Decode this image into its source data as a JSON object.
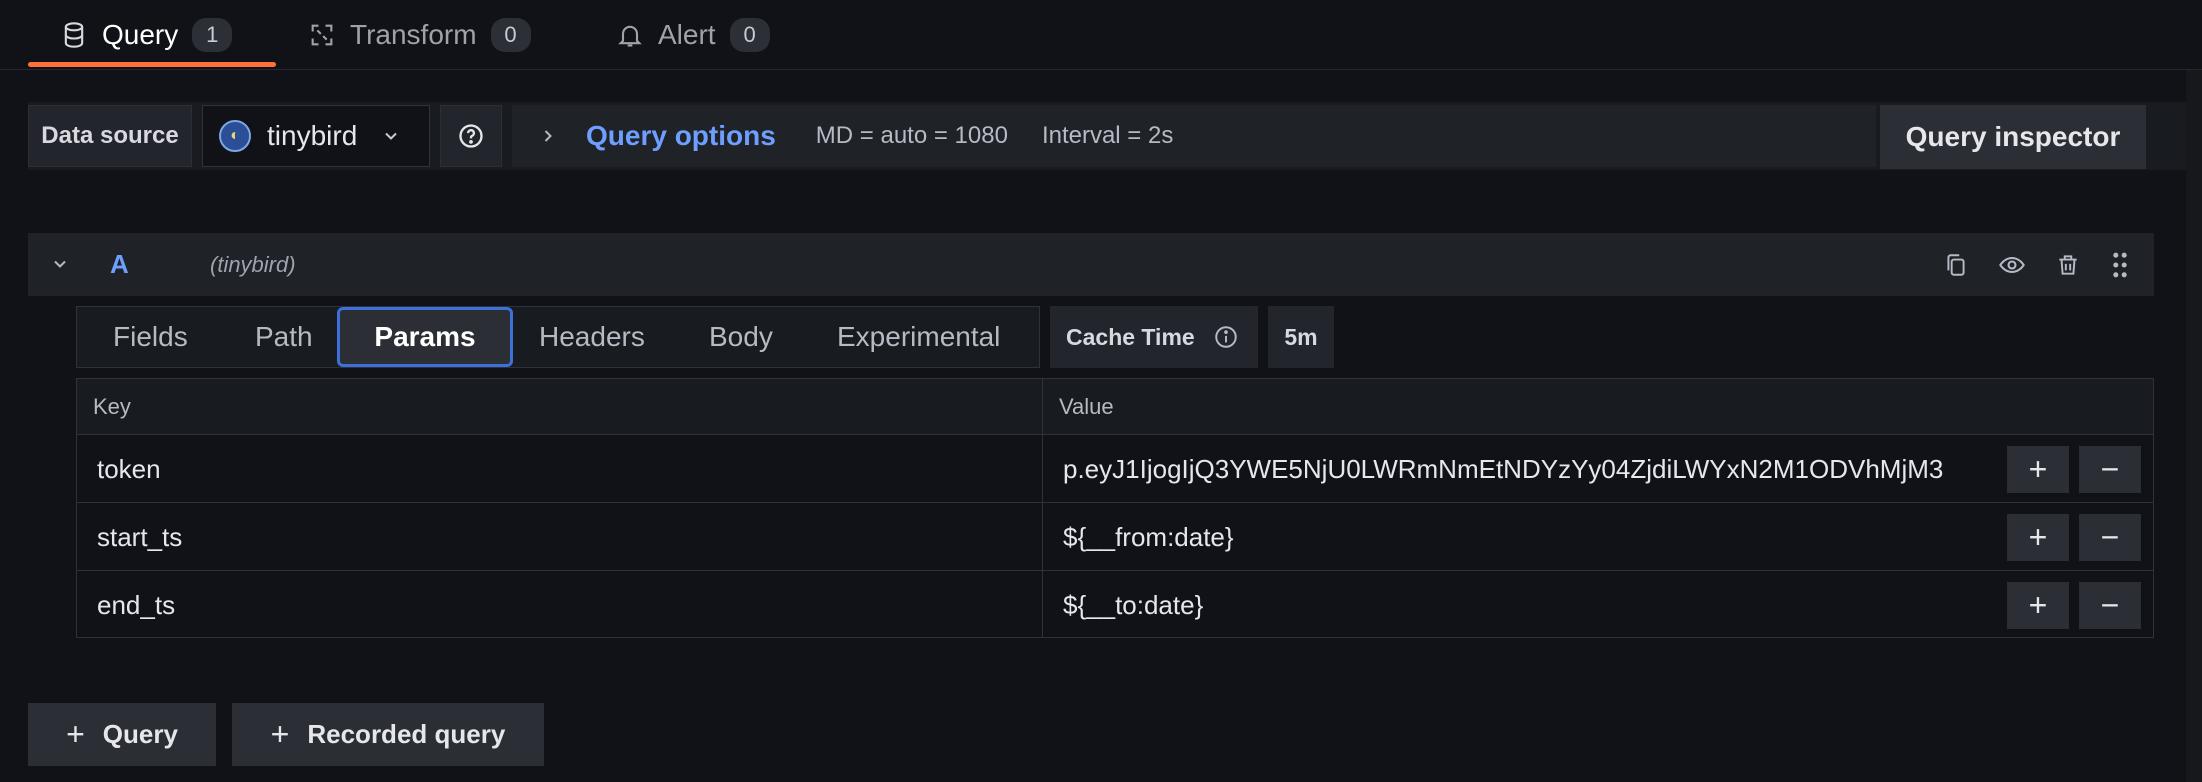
{
  "tabs": [
    {
      "label": "Query",
      "count": "1",
      "icon": "database-icon"
    },
    {
      "label": "Transform",
      "count": "0",
      "icon": "transform-icon"
    },
    {
      "label": "Alert",
      "count": "0",
      "icon": "bell-icon"
    }
  ],
  "toolbar": {
    "datasource_label": "Data source",
    "datasource_value": "tinybird",
    "query_options_label": "Query options",
    "md": "MD = auto = 1080",
    "interval": "Interval = 2s",
    "query_inspector": "Query inspector"
  },
  "query": {
    "letter": "A",
    "datasource": "(tinybird)"
  },
  "subtabs": [
    "Fields",
    "Path",
    "Params",
    "Headers",
    "Body",
    "Experimental"
  ],
  "active_subtab": "Params",
  "cache": {
    "label": "Cache Time",
    "value": "5m"
  },
  "table": {
    "headers": [
      "Key",
      "Value"
    ],
    "rows": [
      {
        "key": "token",
        "value": "p.eyJ1IjogIjQ3YWE5NjU0LWRmNmEtNDYzYy04ZjdiLWYxN2M1ODVhMjM3"
      },
      {
        "key": "start_ts",
        "value": "${__from:date}"
      },
      {
        "key": "end_ts",
        "value": "${__to:date}"
      }
    ]
  },
  "bottom": {
    "add_query": "Query",
    "add_recorded": "Recorded query"
  },
  "colors": {
    "accent_tab": "#ff6f3c",
    "link_blue": "#6e9fff",
    "active_border": "#3d71d9"
  }
}
